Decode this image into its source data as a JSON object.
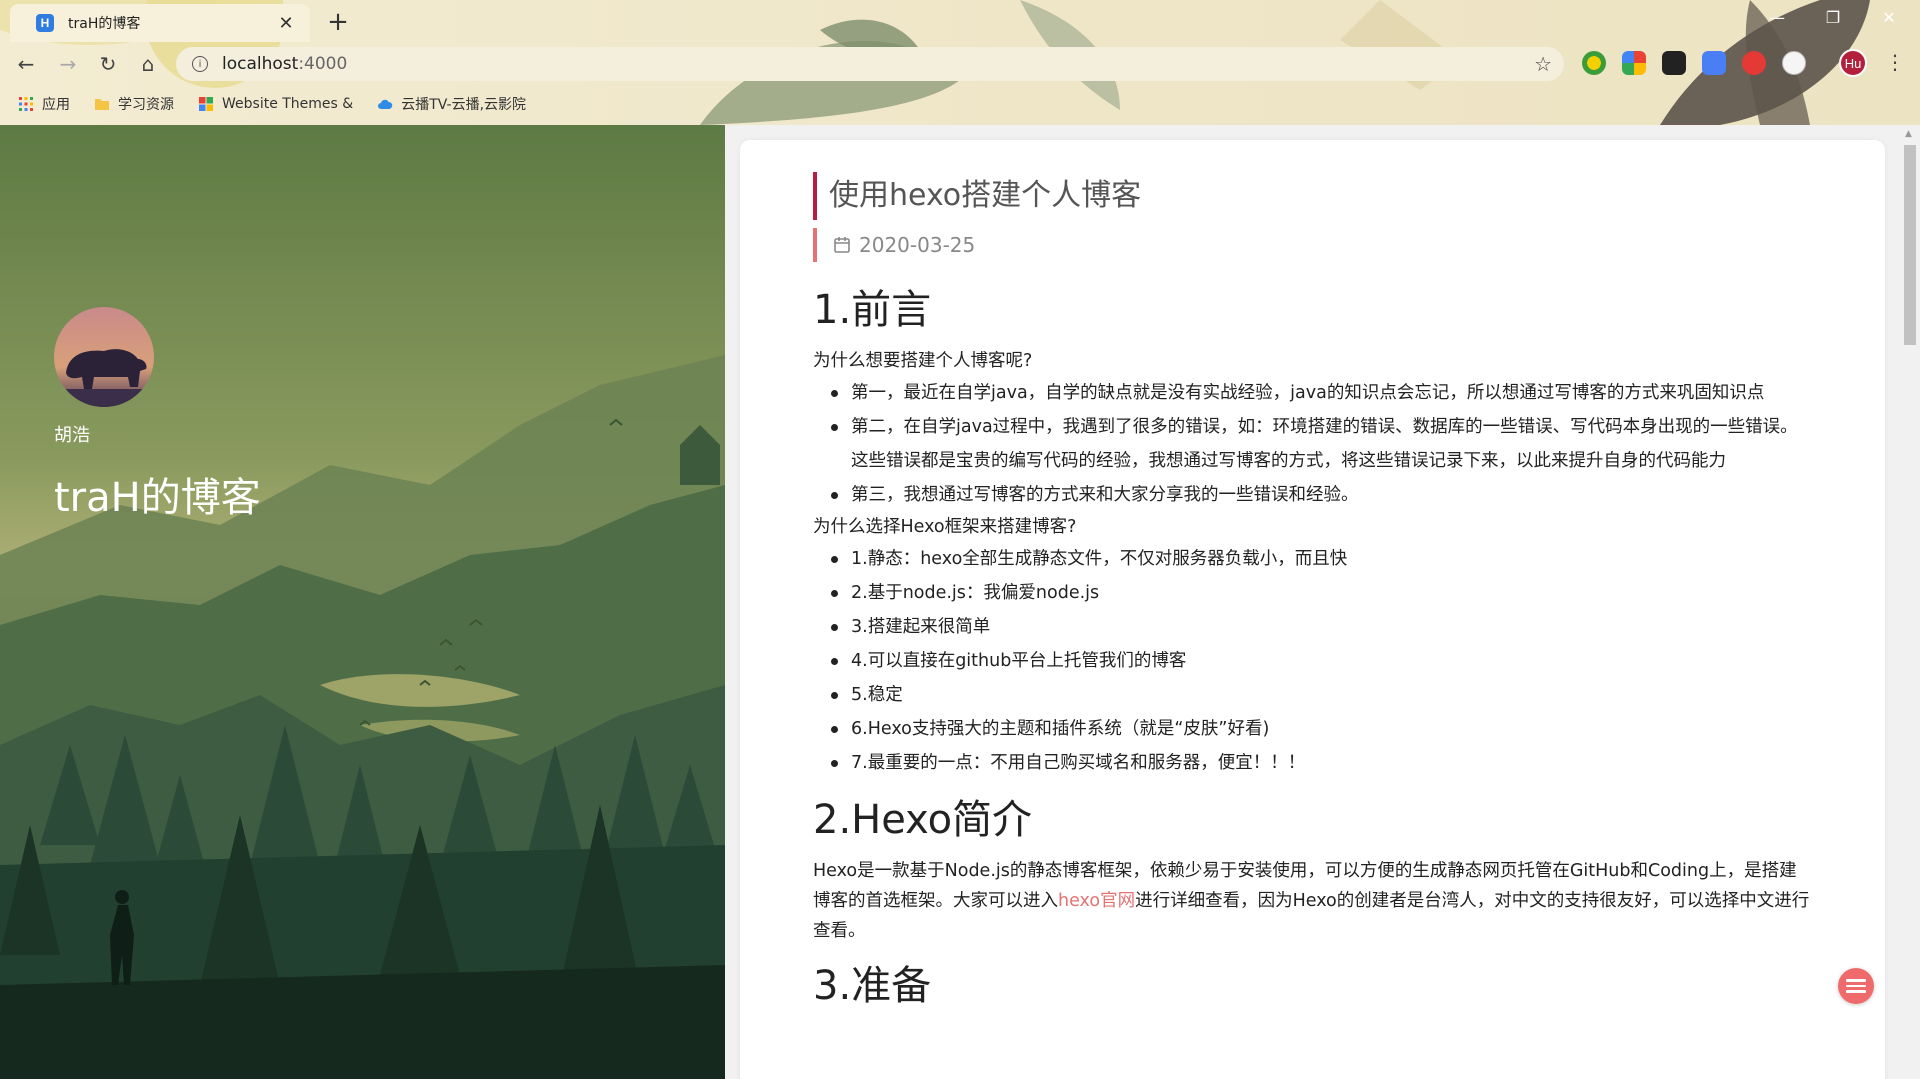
{
  "browser": {
    "tab_title": "traH的博客",
    "tab_close": "✕",
    "new_tab": "+",
    "url_host": "localhost",
    "url_port": ":4000",
    "profile_initials": "Hu",
    "bookmarks": [
      {
        "label": "应用",
        "icon": "apps-grid-icon"
      },
      {
        "label": "学习资源",
        "icon": "folder-icon"
      },
      {
        "label": "Website Themes &",
        "icon": "colorful-squares-icon"
      },
      {
        "label": "云播TV-云播,云影院",
        "icon": "cloud-icon"
      }
    ]
  },
  "sidebar": {
    "author": "胡浩",
    "blog_title": "traH的博客"
  },
  "post": {
    "title": "使用hexo搭建个人博客",
    "date": "2020-03-25",
    "sections": {
      "s1_heading": "1.前言",
      "s1_q1": "为什么想要搭建个人博客呢?",
      "s1_reasons": [
        "第一，最近在自学java，自学的缺点就是没有实战经验，java的知识点会忘记，所以想通过写博客的方式来巩固知识点",
        "第二，在自学java过程中，我遇到了很多的错误，如：环境搭建的错误、数据库的一些错误、写代码本身出现的一些错误。这些错误都是宝贵的编写代码的经验，我想通过写博客的方式，将这些错误记录下来，以此来提升自身的代码能力",
        "第三，我想通过写博客的方式来和大家分享我的一些错误和经验。"
      ],
      "s1_q2": "为什么选择Hexo框架来搭建博客?",
      "s1_features": [
        "1.静态：hexo全部生成静态文件，不仅对服务器负载小，而且快",
        "2.基于node.js：我偏爱node.js",
        "3.搭建起来很简单",
        "4.可以直接在github平台上托管我们的博客",
        "5.稳定",
        "6.Hexo支持强大的主题和插件系统（就是“皮肤”好看)",
        "7.最重要的一点：不用自己购买域名和服务器，便宜！！！"
      ],
      "s2_heading": "2.Hexo简介",
      "s2_text_a": "Hexo是一款基于Node.js的静态博客框架，依赖少易于安装使用，可以方便的生成静态网页托管在GitHub和Coding上，是搭建博客的首选框架。大家可以进入",
      "s2_link": "hexo官网",
      "s2_text_b": "进行详细查看，因为Hexo的创建者是台湾人，对中文的支持很友好，可以选择中文进行查看。",
      "s3_heading": "3.准备"
    }
  },
  "colors": {
    "accent": "#b71c45",
    "link": "#e57373",
    "fab": "#ef6b6b"
  }
}
